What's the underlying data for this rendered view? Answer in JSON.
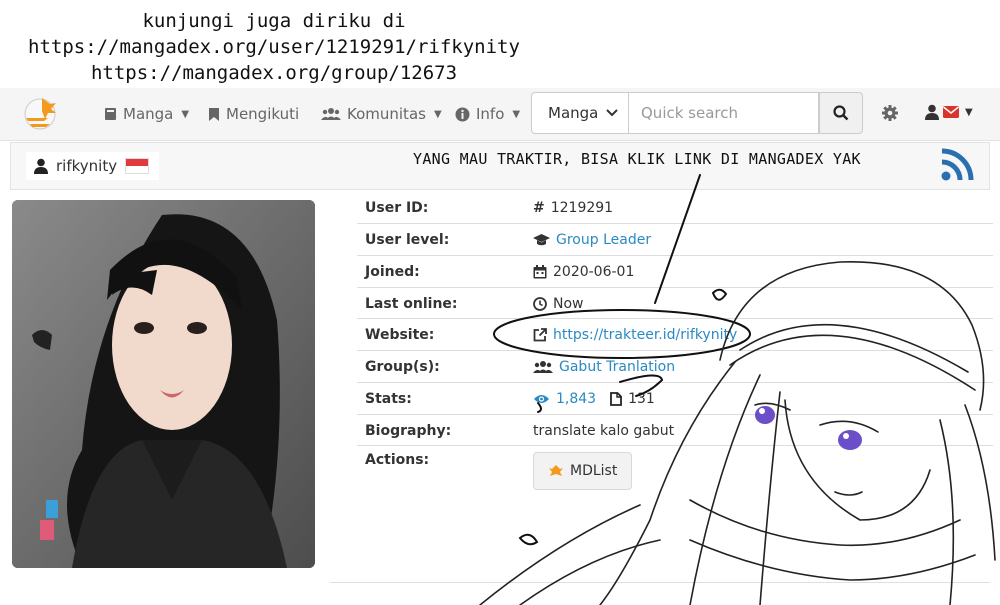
{
  "banner": {
    "line1": "kunjungi juga diriku di",
    "line2": "https://mangadex.org/user/1219291/rifkynity",
    "line3": "https://mangadex.org/group/12673"
  },
  "navbar": {
    "manga_label": "Manga",
    "following_label": "Mengikuti",
    "community_label": "Komunitas",
    "info_label": "Info",
    "search_type": "Manga",
    "search_placeholder": "Quick search"
  },
  "profile": {
    "username": "rifkynity",
    "flag_colors": [
      "#e03a3e",
      "#ffffff"
    ]
  },
  "overlay": {
    "note": "YANG MAU TRAKTIR, BISA KLIK LINK DI MANGADEX YAK"
  },
  "details": {
    "user_id_label": "User ID:",
    "user_id_value": "1219291",
    "level_label": "User level:",
    "level_value": "Group Leader",
    "joined_label": "Joined:",
    "joined_value": "2020-06-01",
    "last_online_label": "Last online:",
    "last_online_value": "Now",
    "website_label": "Website:",
    "website_value": "https://trakteer.id/rifkynity",
    "groups_label": "Group(s):",
    "groups_value": "Gabut Tranlation",
    "stats_label": "Stats:",
    "stats_views": "1,843",
    "stats_uploads": "131",
    "bio_label": "Biography:",
    "bio_value": "translate kalo gabut",
    "actions_label": "Actions:",
    "mdlist_label": "MDList"
  },
  "colors": {
    "link": "#2a8ac4",
    "rss": "#2a6fb0",
    "mail": "#d9342b"
  }
}
